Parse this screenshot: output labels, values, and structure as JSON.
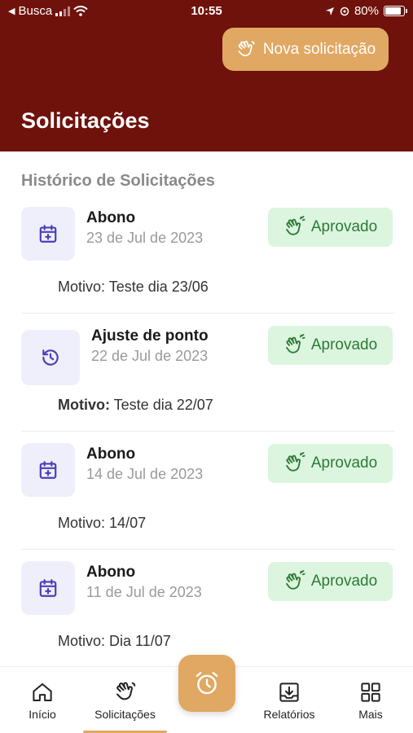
{
  "status_bar": {
    "carrier": "Busca",
    "time": "10:55",
    "battery": "80%"
  },
  "header": {
    "new_request_label": "Nova solicitação",
    "title": "Solicitações"
  },
  "section_title": "Histórico de Solicitações",
  "requests": [
    {
      "icon": "calendar-plus-icon",
      "title": "Abono",
      "date": "23 de Jul de 2023",
      "status": "Aprovado",
      "reason_label": "Motivo:",
      "reason_text": "Teste dia 23/06",
      "reason_label_bold": false
    },
    {
      "icon": "history-icon",
      "title": "Ajuste de ponto",
      "date": "22 de Jul de 2023",
      "status": "Aprovado",
      "reason_label": "Motivo:",
      "reason_text": "Teste dia 22/07",
      "reason_label_bold": true
    },
    {
      "icon": "calendar-plus-icon",
      "title": "Abono",
      "date": "14 de Jul de 2023",
      "status": "Aprovado",
      "reason_label": "Motivo:",
      "reason_text": "14/07",
      "reason_label_bold": false
    },
    {
      "icon": "calendar-plus-icon",
      "title": "Abono",
      "date": "11 de Jul de 2023",
      "status": "Aprovado",
      "reason_label": "Motivo:",
      "reason_text": "Dia 11/07",
      "reason_label_bold": false
    }
  ],
  "nav": {
    "items": [
      {
        "label": "Início",
        "icon": "home-icon"
      },
      {
        "label": "Solicitações",
        "icon": "hand-icon",
        "active": true
      },
      {
        "label": "Relatórios",
        "icon": "download-tray-icon"
      },
      {
        "label": "Mais",
        "icon": "grid-icon"
      }
    ],
    "fab_icon": "alarm-clock-icon"
  },
  "colors": {
    "header": "#6f120c",
    "accent": "#e0a862",
    "approved_bg": "#dcf5df",
    "approved_text": "#2d7a36",
    "icon_box": "#efeefb",
    "icon": "#4a3fb5"
  }
}
